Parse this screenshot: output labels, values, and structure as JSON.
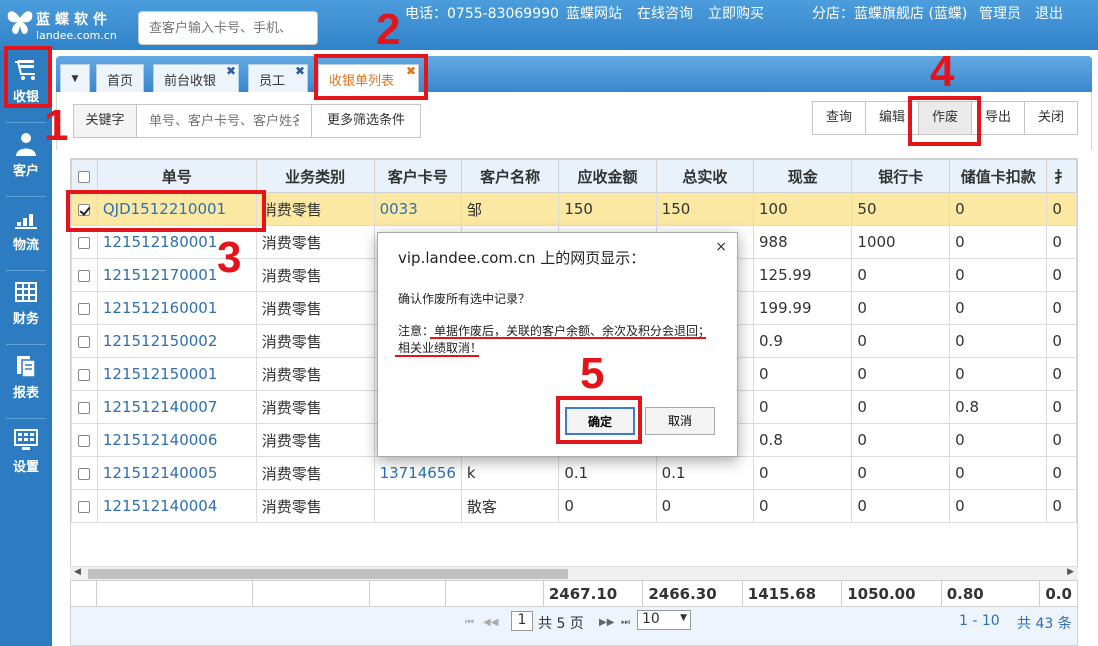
{
  "header": {
    "logo_cn": "蓝蝶软件",
    "logo_en": "landee.com.cn",
    "search_placeholder": "查客户输入卡号、手机、",
    "phone": "电话：0755-83069990",
    "links": [
      "蓝蝶网站",
      "在线咨询",
      "立即购买"
    ],
    "branch": "分店：蓝蝶旗舰店 (蓝蝶)",
    "user": "管理员",
    "logout": "退出"
  },
  "sidebar": {
    "items": [
      {
        "label": "收银",
        "icon": "cart-icon"
      },
      {
        "label": "客户",
        "icon": "user-icon"
      },
      {
        "label": "物流",
        "icon": "logistics-icon"
      },
      {
        "label": "财务",
        "icon": "finance-icon"
      },
      {
        "label": "报表",
        "icon": "report-icon"
      },
      {
        "label": "设置",
        "icon": "settings-icon"
      }
    ]
  },
  "tabs": [
    {
      "label": "首页"
    },
    {
      "label": "前台收银"
    },
    {
      "label": "员工"
    },
    {
      "label": "收银单列表"
    }
  ],
  "filter": {
    "keyword_label": "关键字",
    "keyword_placeholder": "单号、客户卡号、客户姓名",
    "more_filters": "更多筛选条件"
  },
  "toolbar": {
    "query": "查询",
    "edit": "编辑",
    "void": "作废",
    "export": "导出",
    "close": "关闭"
  },
  "table": {
    "columns": [
      "单号",
      "业务类别",
      "客户卡号",
      "客户名称",
      "应收金额",
      "总实收",
      "现金",
      "银行卡",
      "储值卡扣款",
      "扌"
    ],
    "rows": [
      {
        "id": "QJD1512210001",
        "type": "消费零售",
        "card": "0033",
        "name": "邹",
        "due": "150",
        "total": "150",
        "cash": "100",
        "bank": "50",
        "stored": "0",
        "extra": "0",
        "checked": true
      },
      {
        "id": "121512180001",
        "type": "消费零售",
        "card": "",
        "name": "",
        "due": "",
        "total": "",
        "cash": "988",
        "bank": "1000",
        "stored": "0",
        "extra": "0",
        "checked": false
      },
      {
        "id": "121512170001",
        "type": "消费零售",
        "card": "",
        "name": "",
        "due": "",
        "total": "",
        "cash": "125.99",
        "bank": "0",
        "stored": "0",
        "extra": "0",
        "checked": false
      },
      {
        "id": "121512160001",
        "type": "消费零售",
        "card": "",
        "name": "",
        "due": "",
        "total": "",
        "cash": "199.99",
        "bank": "0",
        "stored": "0",
        "extra": "0",
        "checked": false
      },
      {
        "id": "121512150002",
        "type": "消费零售",
        "card": "",
        "name": "",
        "due": "",
        "total": "",
        "cash": "0.9",
        "bank": "0",
        "stored": "0",
        "extra": "0",
        "checked": false
      },
      {
        "id": "121512150001",
        "type": "消费零售",
        "card": "",
        "name": "",
        "due": "",
        "total": "",
        "cash": "0",
        "bank": "0",
        "stored": "0",
        "extra": "0",
        "checked": false
      },
      {
        "id": "121512140007",
        "type": "消费零售",
        "card": "",
        "name": "",
        "due": "",
        "total": "",
        "cash": "0",
        "bank": "0",
        "stored": "0.8",
        "extra": "0",
        "checked": false
      },
      {
        "id": "121512140006",
        "type": "消费零售",
        "card": "",
        "name": "",
        "due": "",
        "total": "",
        "cash": "0.8",
        "bank": "0",
        "stored": "0",
        "extra": "0",
        "checked": false
      },
      {
        "id": "121512140005",
        "type": "消费零售",
        "card": "13714656",
        "name": "k",
        "due": "0.1",
        "total": "0.1",
        "cash": "0",
        "bank": "0",
        "stored": "0",
        "extra": "0",
        "checked": false
      },
      {
        "id": "121512140004",
        "type": "消费零售",
        "card": "",
        "name": "散客",
        "due": "0",
        "total": "0",
        "cash": "0",
        "bank": "0",
        "stored": "0",
        "extra": "0",
        "checked": false
      }
    ],
    "totals": {
      "due": "2467.10",
      "total": "2466.30",
      "cash": "1415.68",
      "bank": "1050.00",
      "stored": "0.80",
      "extra": "0.0"
    }
  },
  "pager": {
    "page": "1",
    "of_pages": "共 5 页",
    "page_size": "10",
    "range": "1 - 10",
    "count": "共 43 条"
  },
  "dialog": {
    "title": "vip.landee.com.cn 上的网页显示：",
    "question": "确认作废所有选中记录？",
    "note_line1": "注意：单据作废后，关联的客户余额、余次及积分会退回；",
    "note_line2": "相关业绩取消！",
    "ok": "确定",
    "cancel": "取消",
    "close": "×"
  },
  "annotations": {
    "step1": "1",
    "step2": "2",
    "step3": "3",
    "step4": "4",
    "step5": "5"
  },
  "colors": {
    "header": "#3a8ed0",
    "sidebar": "#2d7cc1",
    "selected_row": "#fbe9a3",
    "link": "#2f6fb3",
    "annotation": "#e5141b",
    "active_tab": "#e4731a"
  }
}
